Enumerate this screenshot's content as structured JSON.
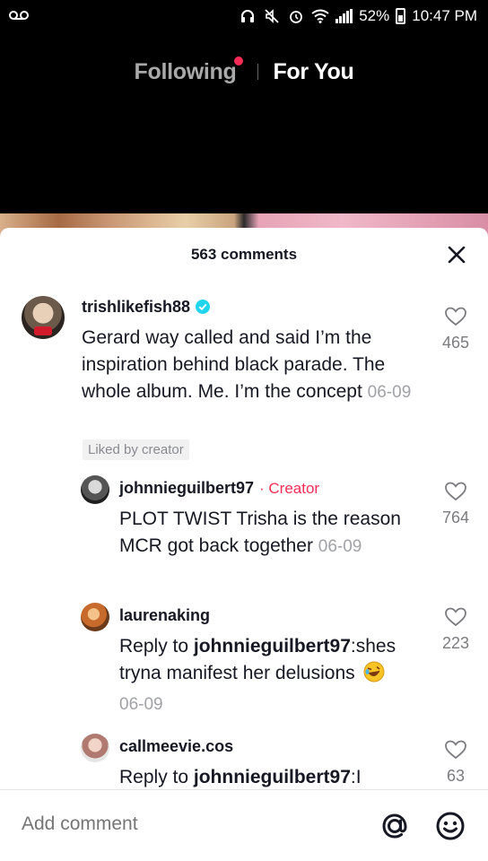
{
  "status_bar": {
    "left_icon": "voicemail-icon",
    "battery": "52%",
    "time": "10:47 PM"
  },
  "top_tabs": {
    "following": "Following",
    "for_you": "For You"
  },
  "comments_sheet": {
    "count_label": "563 comments",
    "comments": [
      {
        "username": "trishlikefish88",
        "verified": true,
        "text": "Gerard way called and said I’m the inspiration behind black parade. The whole album. Me. I’m the concept",
        "date": "06-09",
        "likes": "465",
        "badge": "Liked by creator"
      },
      {
        "username": "johnnieguilbert97",
        "creator_tag": "· Creator",
        "text": "PLOT TWIST Trisha is the reason MCR got back together",
        "date": "06-09",
        "likes": "764"
      },
      {
        "username": "laurenaking",
        "reply_prefix": "Reply to ",
        "reply_to": "johnnieguilbert97",
        "text": ":shes tryna manifest her delusions",
        "date": "06-09",
        "likes": "223"
      },
      {
        "username": "callmeevie.cos",
        "reply_prefix": "Reply to ",
        "reply_to": "johnnieguilbert97",
        "text": ":I",
        "likes": "63"
      }
    ]
  },
  "bottom_bar": {
    "placeholder": "Add comment"
  },
  "colors": {
    "accent": "#fe2c55",
    "verified": "#20d5ec",
    "muted_text": "#a1a2a7"
  }
}
